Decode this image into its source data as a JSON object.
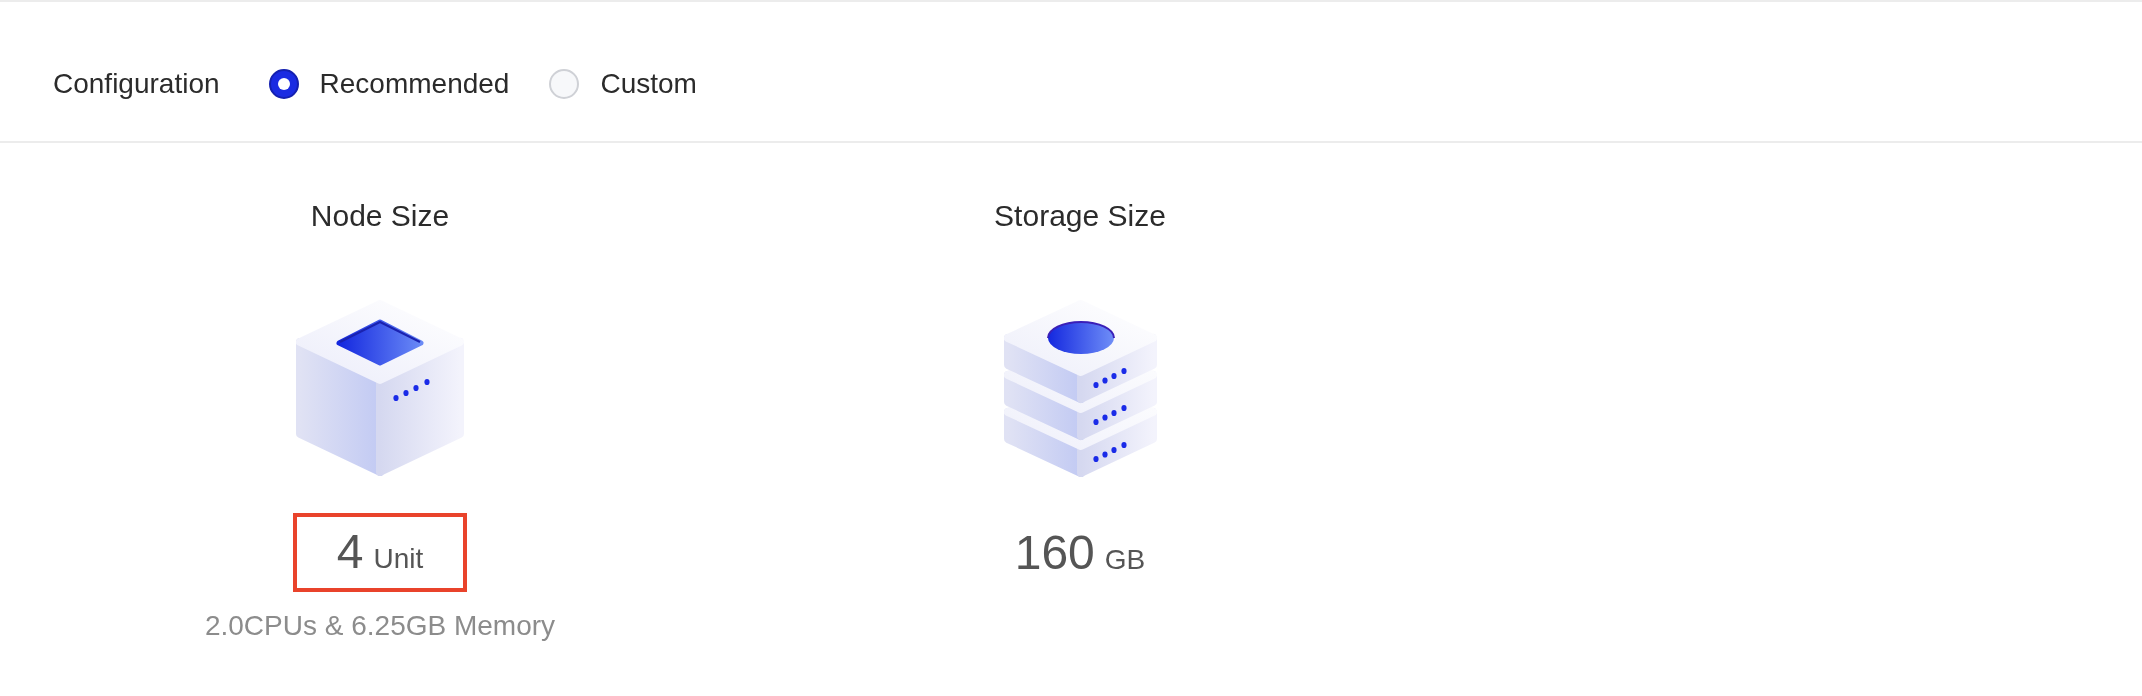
{
  "configuration": {
    "label": "Configuration",
    "options": [
      {
        "label": "Recommended",
        "selected": true
      },
      {
        "label": "Custom",
        "selected": false
      }
    ]
  },
  "resources": [
    {
      "kind": "node",
      "title": "Node Size",
      "value": "4",
      "unit": "Unit",
      "highlighted": true,
      "detail": "2.0CPUs & 6.25GB Memory"
    },
    {
      "kind": "storage",
      "title": "Storage Size",
      "value": "160",
      "unit": "GB",
      "highlighted": false
    }
  ]
}
